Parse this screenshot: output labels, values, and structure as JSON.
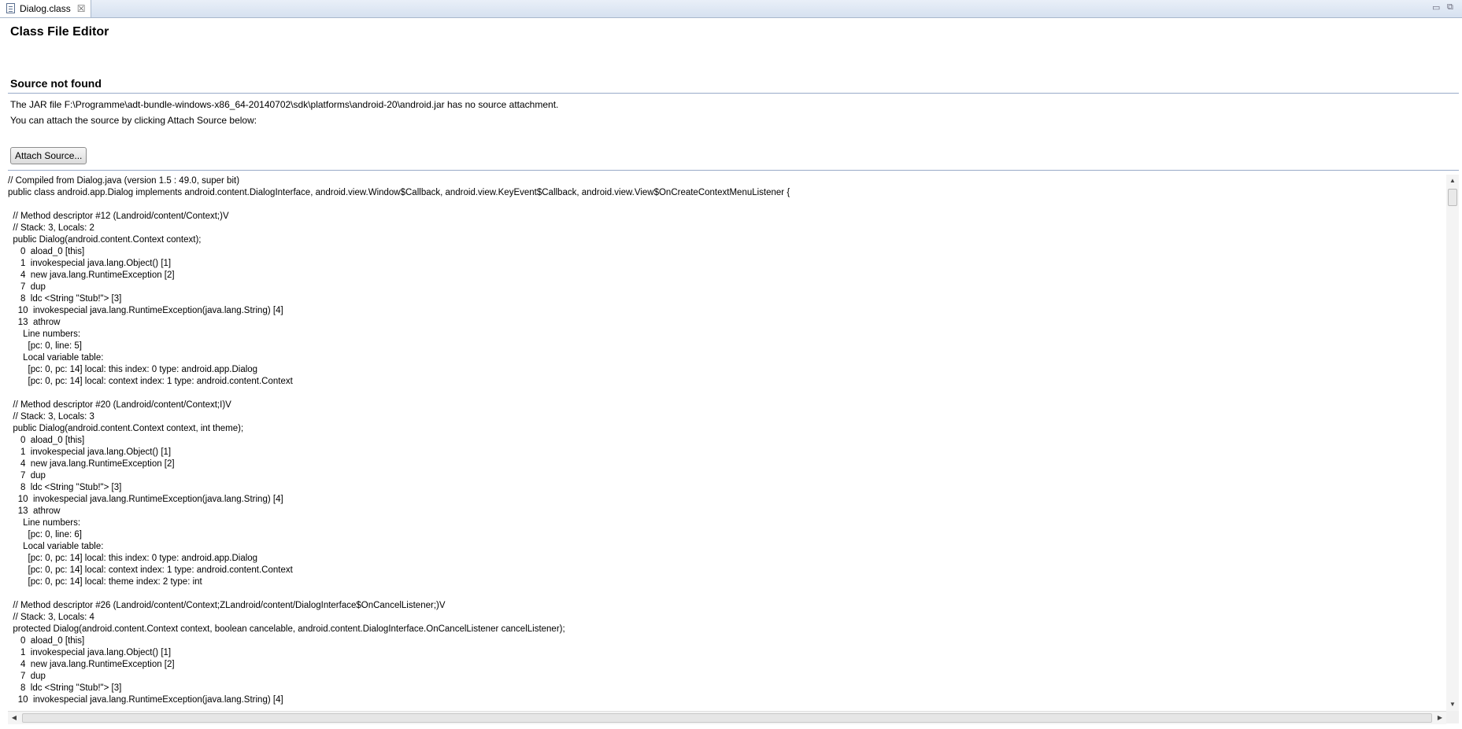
{
  "tab": {
    "label": "Dialog.class",
    "close": "☒"
  },
  "window_controls": {
    "minimize": "▭",
    "maximize": "⧉"
  },
  "editor": {
    "title": "Class File Editor",
    "section_title": "Source not found",
    "message_line1": "The JAR file F:\\Programme\\adt-bundle-windows-x86_64-20140702\\sdk\\platforms\\android-20\\android.jar has no source attachment.",
    "message_line2": "You can attach the source by clicking Attach Source below:",
    "attach_button": "Attach Source..."
  },
  "code_lines": [
    "// Compiled from Dialog.java (version 1.5 : 49.0, super bit)",
    "public class android.app.Dialog implements android.content.DialogInterface, android.view.Window$Callback, android.view.KeyEvent$Callback, android.view.View$OnCreateContextMenuListener {",
    "",
    "  // Method descriptor #12 (Landroid/content/Context;)V",
    "  // Stack: 3, Locals: 2",
    "  public Dialog(android.content.Context context);",
    "     0  aload_0 [this]",
    "     1  invokespecial java.lang.Object() [1]",
    "     4  new java.lang.RuntimeException [2]",
    "     7  dup",
    "     8  ldc <String \"Stub!\"> [3]",
    "    10  invokespecial java.lang.RuntimeException(java.lang.String) [4]",
    "    13  athrow",
    "      Line numbers:",
    "        [pc: 0, line: 5]",
    "      Local variable table:",
    "        [pc: 0, pc: 14] local: this index: 0 type: android.app.Dialog",
    "        [pc: 0, pc: 14] local: context index: 1 type: android.content.Context",
    "",
    "  // Method descriptor #20 (Landroid/content/Context;I)V",
    "  // Stack: 3, Locals: 3",
    "  public Dialog(android.content.Context context, int theme);",
    "     0  aload_0 [this]",
    "     1  invokespecial java.lang.Object() [1]",
    "     4  new java.lang.RuntimeException [2]",
    "     7  dup",
    "     8  ldc <String \"Stub!\"> [3]",
    "    10  invokespecial java.lang.RuntimeException(java.lang.String) [4]",
    "    13  athrow",
    "      Line numbers:",
    "        [pc: 0, line: 6]",
    "      Local variable table:",
    "        [pc: 0, pc: 14] local: this index: 0 type: android.app.Dialog",
    "        [pc: 0, pc: 14] local: context index: 1 type: android.content.Context",
    "        [pc: 0, pc: 14] local: theme index: 2 type: int",
    "",
    "  // Method descriptor #26 (Landroid/content/Context;ZLandroid/content/DialogInterface$OnCancelListener;)V",
    "  // Stack: 3, Locals: 4",
    "  protected Dialog(android.content.Context context, boolean cancelable, android.content.DialogInterface.OnCancelListener cancelListener);",
    "     0  aload_0 [this]",
    "     1  invokespecial java.lang.Object() [1]",
    "     4  new java.lang.RuntimeException [2]",
    "     7  dup",
    "     8  ldc <String \"Stub!\"> [3]",
    "    10  invokespecial java.lang.RuntimeException(java.lang.String) [4]"
  ],
  "scrollbars": {
    "up": "▲",
    "down": "▼",
    "left": "◀",
    "right": "▶"
  }
}
